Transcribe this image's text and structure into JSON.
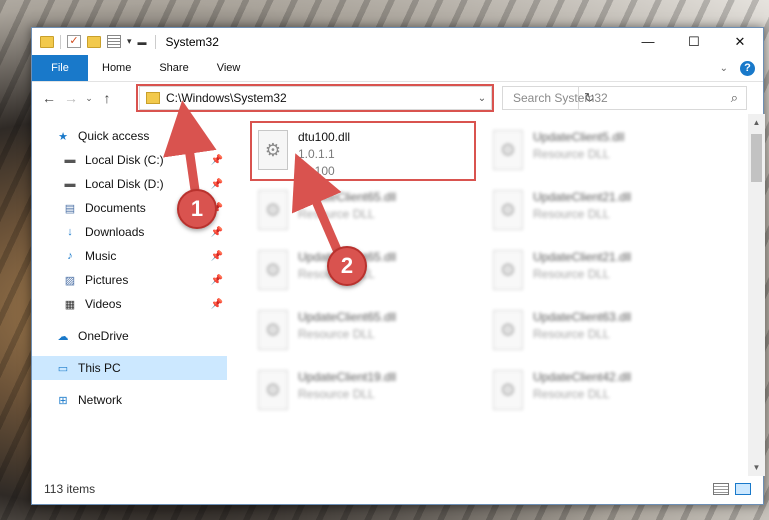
{
  "window": {
    "title": "System32"
  },
  "title_controls": {
    "minimize": "—",
    "maximize": "☐",
    "close": "✕"
  },
  "ribbon": {
    "tabs": [
      {
        "label": "File"
      },
      {
        "label": "Home"
      },
      {
        "label": "Share"
      },
      {
        "label": "View"
      }
    ]
  },
  "address": {
    "path": "C:\\Windows\\System32"
  },
  "search": {
    "placeholder": "Search System32"
  },
  "sidebar": {
    "items": [
      {
        "label": "Quick access",
        "icon": "star-icon"
      },
      {
        "label": "Local Disk (C:)",
        "icon": "drive-icon"
      },
      {
        "label": "Local Disk (D:)",
        "icon": "drive-icon"
      },
      {
        "label": "Documents",
        "icon": "documents-icon"
      },
      {
        "label": "Downloads",
        "icon": "download-icon"
      },
      {
        "label": "Music",
        "icon": "music-icon"
      },
      {
        "label": "Pictures",
        "icon": "pictures-icon"
      },
      {
        "label": "Videos",
        "icon": "videos-icon"
      },
      {
        "label": "OneDrive",
        "icon": "cloud-icon"
      },
      {
        "label": "This PC",
        "icon": "computer-icon"
      },
      {
        "label": "Network",
        "icon": "network-icon"
      }
    ]
  },
  "files": [
    {
      "name": "dtu100.dll",
      "line2": "1.0.1.1",
      "line3": "dtu100"
    },
    {
      "name": "UpdateClient5.dll",
      "line2": "Resource DLL"
    },
    {
      "name": "UpdateClient65.dll",
      "line2": "Resource DLL"
    },
    {
      "name": "UpdateClient21.dll",
      "line2": "Resource DLL"
    },
    {
      "name": "UpdateClient65.dll",
      "line2": "Resource DLL"
    },
    {
      "name": "UpdateClient21.dll",
      "line2": "Resource DLL"
    },
    {
      "name": "UpdateClient65.dll",
      "line2": "Resource DLL"
    },
    {
      "name": "UpdateClient63.dll",
      "line2": "Resource DLL"
    },
    {
      "name": "UpdateClient19.dll",
      "line2": "Resource DLL"
    },
    {
      "name": "UpdateClient42.dll",
      "line2": "Resource DLL"
    }
  ],
  "status": {
    "item_count": "113 items"
  },
  "callouts": {
    "one": "1",
    "two": "2"
  },
  "colors": {
    "accent": "#1979ca",
    "highlight": "#d9534f",
    "selected": "#cce8ff"
  }
}
